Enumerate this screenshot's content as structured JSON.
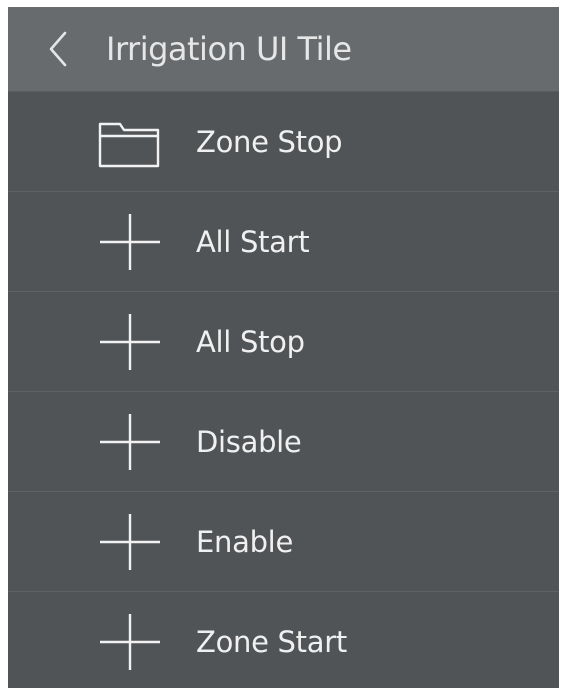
{
  "header": {
    "title": "Irrigation UI Tile",
    "back_icon": "chevron-left-icon"
  },
  "items": [
    {
      "label": "Zone Stop",
      "icon": "folder-icon"
    },
    {
      "label": "All Start",
      "icon": "plus-icon"
    },
    {
      "label": "All Stop",
      "icon": "plus-icon"
    },
    {
      "label": "Disable",
      "icon": "plus-icon"
    },
    {
      "label": "Enable",
      "icon": "plus-icon"
    },
    {
      "label": "Zone Start",
      "icon": "plus-icon"
    }
  ],
  "colors": {
    "panel_bg": "#515457",
    "header_bg": "#686b6e",
    "text": "#f0f0f0",
    "icon_stroke": "#f2f2f2"
  }
}
